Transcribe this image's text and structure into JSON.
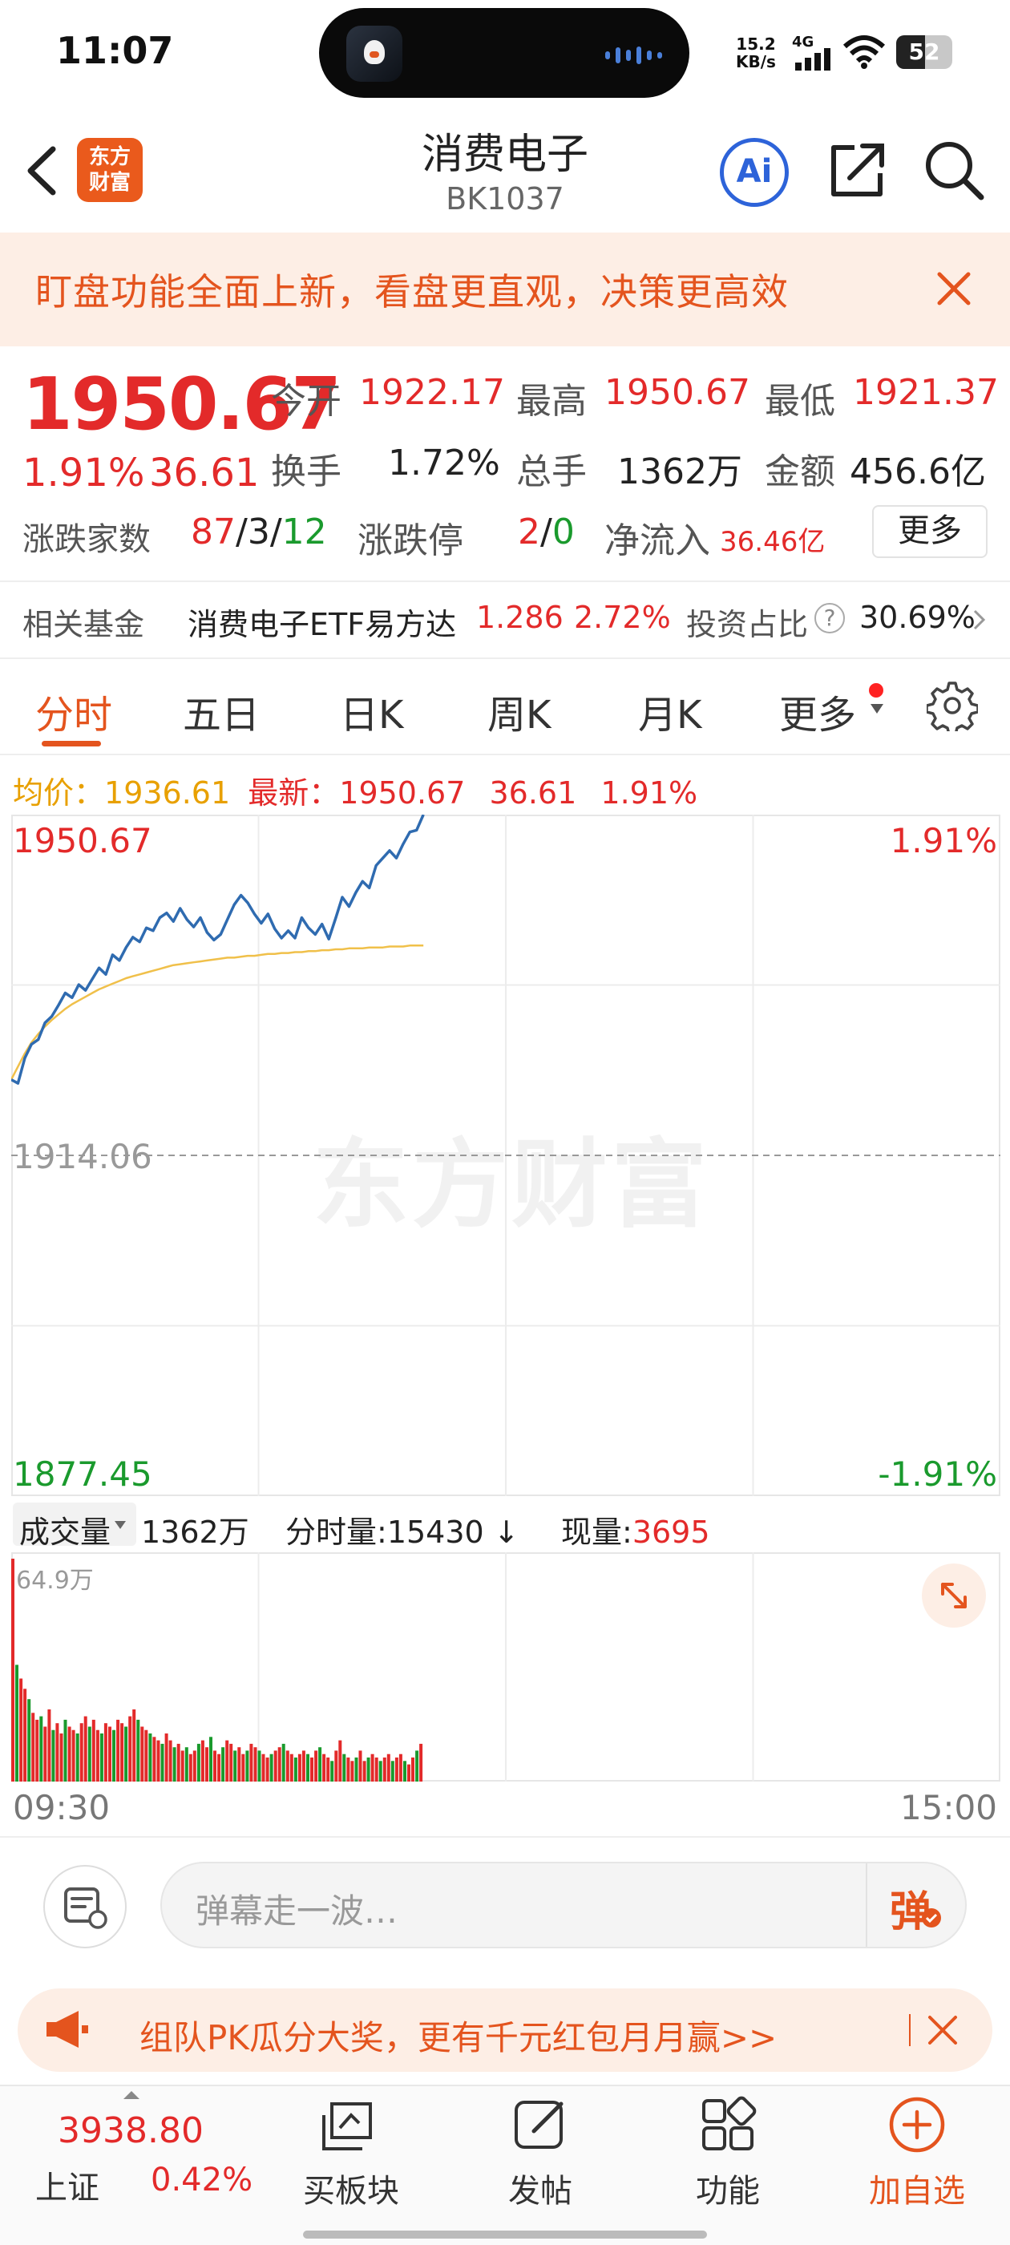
{
  "status_bar": {
    "time": "11:07",
    "net_speed_value": "15.2",
    "net_speed_unit": "KB/s",
    "network": "4G",
    "battery": "52"
  },
  "header": {
    "logo_line1": "东方",
    "logo_line2": "财富",
    "title": "消费电子",
    "code": "BK1037",
    "ai_label": "Ai"
  },
  "banner": {
    "text": "盯盘功能全面上新，看盘更直观，决策更高效"
  },
  "quote": {
    "price": "1950.67",
    "change_pct": "1.91%",
    "change_val": "36.61",
    "open_label": "今开",
    "open": "1922.17",
    "high_label": "最高",
    "high": "1950.67",
    "low_label": "最低",
    "low": "1921.37",
    "turnover_label": "换手",
    "turnover": "1.72%",
    "volume_label": "总手",
    "volume": "1362万",
    "amount_label": "金额",
    "amount": "456.6亿",
    "breadth_label": "涨跌家数",
    "up": "87",
    "flat": "3",
    "down": "12",
    "limit_label": "涨跌停",
    "limit_up": "2",
    "limit_down": "0",
    "netflow_label": "净流入",
    "netflow": "36.46亿",
    "more_label": "更多",
    "sep": "/"
  },
  "fund": {
    "label": "相关基金",
    "name": "消费电子ETF易方达",
    "price": "1.286",
    "pct": "2.72%",
    "ratio_label": "投资占比",
    "ratio": "30.69%"
  },
  "tabs": [
    {
      "label": "分时"
    },
    {
      "label": "五日"
    },
    {
      "label": "日K"
    },
    {
      "label": "周K"
    },
    {
      "label": "月K"
    },
    {
      "label": "更多"
    }
  ],
  "avg_row": {
    "avg_label": "均价：",
    "avg": "1936.61",
    "last_label": "最新：",
    "last": "1950.67",
    "chg": "36.61",
    "pct": "1.91%"
  },
  "chart_labels": {
    "y_top": "1950.67",
    "y_mid": "1914.06",
    "y_bottom": "1877.45",
    "pct_top": "1.91%",
    "pct_bottom": "-1.91%",
    "watermark": "东方财富",
    "vol_label": "成交量",
    "vol_total": "1362万",
    "tick_vol_label": "分时量:",
    "tick_vol": "15430",
    "tick_arrow": "↓",
    "now_vol_label": "现量:",
    "now_vol": "3695",
    "vol_max": "64.9万",
    "time_start": "09:30",
    "time_end": "15:00"
  },
  "chart_data": {
    "type": "line",
    "x_range": [
      "09:30",
      "15:00"
    ],
    "ylim": [
      1877.45,
      1950.67
    ],
    "baseline": 1914.06,
    "series": [
      {
        "name": "最新",
        "color": "#2f6bb0",
        "values": [
          1922.2,
          1921.8,
          1924.5,
          1926.0,
          1926.5,
          1928.3,
          1929.0,
          1930.2,
          1931.5,
          1931.0,
          1932.4,
          1931.8,
          1933.0,
          1934.2,
          1933.5,
          1935.6,
          1935.0,
          1936.4,
          1937.5,
          1937.0,
          1938.5,
          1938.2,
          1939.6,
          1940.1,
          1939.2,
          1940.6,
          1939.4,
          1938.6,
          1939.6,
          1938.0,
          1937.2,
          1937.8,
          1939.4,
          1941.0,
          1942.0,
          1941.2,
          1940.0,
          1939.0,
          1940.0,
          1938.4,
          1937.4,
          1938.2,
          1937.4,
          1939.6,
          1938.5,
          1937.8,
          1938.9,
          1937.3,
          1939.5,
          1941.8,
          1940.8,
          1942.3,
          1943.5,
          1942.8,
          1945.2,
          1946.0,
          1946.8,
          1946.0,
          1947.5,
          1948.8,
          1949.0,
          1950.67
        ]
      },
      {
        "name": "均价",
        "color": "#f0c04a",
        "values": [
          1922.2,
          1923.6,
          1925.0,
          1926.2,
          1927.1,
          1927.9,
          1928.6,
          1929.2,
          1929.8,
          1930.3,
          1930.7,
          1931.1,
          1931.5,
          1931.9,
          1932.2,
          1932.5,
          1932.8,
          1933.1,
          1933.3,
          1933.5,
          1933.7,
          1933.9,
          1934.1,
          1934.3,
          1934.5,
          1934.6,
          1934.7,
          1934.8,
          1934.9,
          1935.0,
          1935.1,
          1935.2,
          1935.3,
          1935.3,
          1935.4,
          1935.5,
          1935.5,
          1935.6,
          1935.7,
          1935.7,
          1935.8,
          1935.8,
          1935.9,
          1935.9,
          1936.0,
          1936.0,
          1936.1,
          1936.1,
          1936.2,
          1936.2,
          1936.3,
          1936.3,
          1936.3,
          1936.4,
          1936.4,
          1936.4,
          1936.5,
          1936.5,
          1936.5,
          1936.6,
          1936.6,
          1936.61
        ]
      }
    ],
    "volume": {
      "ylim_max": 64.9,
      "unit": "万",
      "values": [
        64.9,
        34,
        30,
        27,
        24,
        20,
        18,
        19,
        16,
        21,
        15,
        17,
        14,
        18,
        16,
        15,
        14,
        17,
        19,
        16,
        18,
        15,
        14,
        17,
        16,
        15,
        18,
        17,
        16,
        19,
        21,
        18,
        16,
        15,
        14,
        13,
        12,
        11,
        14,
        12,
        10,
        11,
        9,
        10,
        8,
        9,
        11,
        12,
        10,
        13,
        9,
        8,
        10,
        12,
        11,
        9,
        10,
        8,
        9,
        11,
        10,
        9,
        8,
        7,
        8,
        9,
        10,
        11,
        9,
        8,
        7,
        8,
        9,
        8,
        7,
        9,
        10,
        8,
        7,
        6,
        9,
        12,
        8,
        7,
        6,
        7,
        9,
        6,
        7,
        8,
        7,
        6,
        7,
        8,
        6,
        7,
        8,
        6,
        5,
        7,
        9,
        11
      ],
      "colors_hint": "red=up, green=down"
    }
  },
  "comment": {
    "placeholder": "弹幕走一波…",
    "dan": "弹"
  },
  "promo": {
    "text": "组队PK瓜分大奖，更有千元红包月月赢>>"
  },
  "bottom_nav": {
    "index_value": "3938.80",
    "index_name": "上证",
    "index_pct": "0.42%",
    "items": [
      {
        "label": "买板块"
      },
      {
        "label": "发帖"
      },
      {
        "label": "功能"
      },
      {
        "label": "加自选"
      }
    ]
  },
  "colors": {
    "accent": "#e4541e",
    "up": "#e32a2a",
    "down": "#1a9a2d",
    "price_line": "#2f6bb0",
    "avg_line": "#f0c04a"
  }
}
